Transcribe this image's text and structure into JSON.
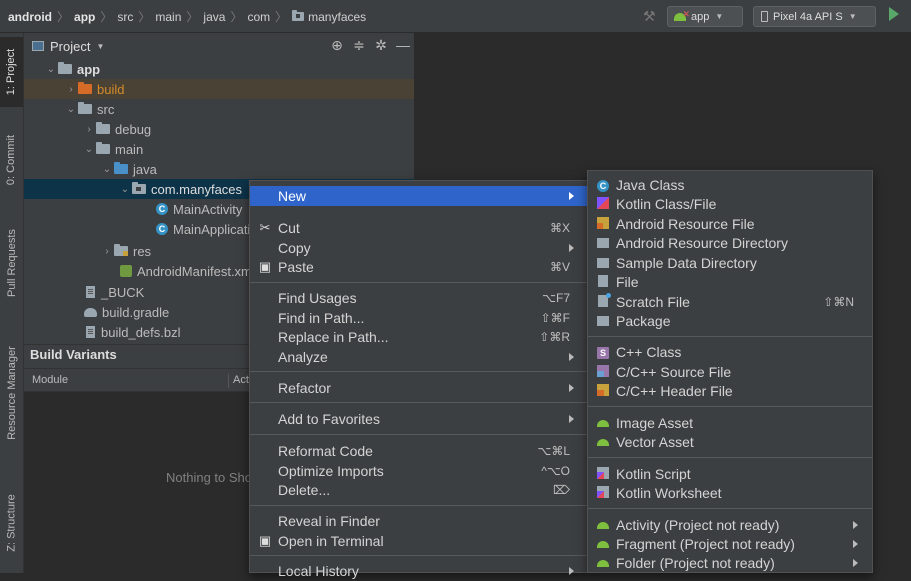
{
  "breadcrumb": [
    "android",
    "app",
    "src",
    "main",
    "java",
    "com",
    "manyfaces"
  ],
  "toolbar": {
    "run_config": "app",
    "device": "Pixel 4a API S"
  },
  "left_stripe": {
    "tabs": [
      "1: Project",
      "0: Commit",
      "Pull Requests",
      "Resource Manager",
      "Z: Structure"
    ]
  },
  "project_panel": {
    "title": "Project",
    "tree": [
      {
        "label": "app",
        "level": 1,
        "expanded": true
      },
      {
        "label": "build",
        "level": 2,
        "expanded": false
      },
      {
        "label": "src",
        "level": 2,
        "expanded": true
      },
      {
        "label": "debug",
        "level": 3,
        "expanded": false
      },
      {
        "label": "main",
        "level": 3,
        "expanded": true
      },
      {
        "label": "java",
        "level": 4,
        "expanded": true
      },
      {
        "label": "com.manyfaces",
        "level": 5,
        "expanded": true,
        "selected": true
      },
      {
        "label": "MainActivity",
        "level": 6
      },
      {
        "label": "MainApplication",
        "level": 6
      },
      {
        "label": "res",
        "level": 4,
        "expanded": false
      },
      {
        "label": "AndroidManifest.xml",
        "level": 4
      },
      {
        "label": "_BUCK",
        "level": 2
      },
      {
        "label": "build.gradle",
        "level": 2
      },
      {
        "label": "build_defs.bzl",
        "level": 2
      }
    ]
  },
  "build_variants": {
    "title": "Build Variants",
    "col_module": "Module",
    "col_active": "Active Build Variant",
    "empty_text": "Nothing to Show"
  },
  "context_menu": [
    {
      "label": "New",
      "shortcut": "",
      "submenu": true,
      "highlighted": true
    },
    {
      "label": "Cut",
      "shortcut": "⌘X",
      "icon": "cut-icon"
    },
    {
      "label": "Copy",
      "shortcut": "",
      "submenu": true
    },
    {
      "label": "Paste",
      "shortcut": "⌘V",
      "icon": "paste-icon"
    },
    {
      "label": "Find Usages",
      "shortcut": "⌥F7"
    },
    {
      "label": "Find in Path...",
      "shortcut": "⇧⌘F"
    },
    {
      "label": "Replace in Path...",
      "shortcut": "⇧⌘R"
    },
    {
      "label": "Analyze",
      "shortcut": "",
      "submenu": true
    },
    {
      "label": "Refactor",
      "shortcut": "",
      "submenu": true
    },
    {
      "label": "Add to Favorites",
      "shortcut": "",
      "submenu": true
    },
    {
      "label": "Reformat Code",
      "shortcut": "⌥⌘L"
    },
    {
      "label": "Optimize Imports",
      "shortcut": "^⌥O"
    },
    {
      "label": "Delete...",
      "shortcut": "⌦"
    },
    {
      "label": "Reveal in Finder",
      "shortcut": ""
    },
    {
      "label": "Open in Terminal",
      "shortcut": "",
      "icon": "terminal-icon"
    },
    {
      "label": "Local History",
      "shortcut": "",
      "submenu": true
    }
  ],
  "new_submenu": [
    {
      "label": "Java Class",
      "icon": "java-class-icon"
    },
    {
      "label": "Kotlin Class/File",
      "icon": "kotlin-icon"
    },
    {
      "label": "Android Resource File",
      "icon": "android-resource-file-icon"
    },
    {
      "label": "Android Resource Directory",
      "icon": "folder-icon"
    },
    {
      "label": "Sample Data Directory",
      "icon": "folder-icon"
    },
    {
      "label": "File",
      "icon": "file-icon"
    },
    {
      "label": "Scratch File",
      "icon": "scratch-file-icon",
      "shortcut": "⇧⌘N"
    },
    {
      "label": "Package",
      "icon": "package-icon"
    },
    {
      "label": "C++ Class",
      "icon": "cpp-class-icon"
    },
    {
      "label": "C/C++ Source File",
      "icon": "cpp-source-icon"
    },
    {
      "label": "C/C++ Header File",
      "icon": "cpp-header-icon"
    },
    {
      "label": "Image Asset",
      "icon": "android-icon"
    },
    {
      "label": "Vector Asset",
      "icon": "android-icon"
    },
    {
      "label": "Kotlin Script",
      "icon": "kotlin-script-icon"
    },
    {
      "label": "Kotlin Worksheet",
      "icon": "kotlin-script-icon"
    },
    {
      "label": "Activity (Project not ready)",
      "icon": "android-icon",
      "submenu": true
    },
    {
      "label": "Fragment (Project not ready)",
      "icon": "android-icon",
      "submenu": true
    },
    {
      "label": "Folder (Project not ready)",
      "icon": "android-icon",
      "submenu": true
    }
  ]
}
